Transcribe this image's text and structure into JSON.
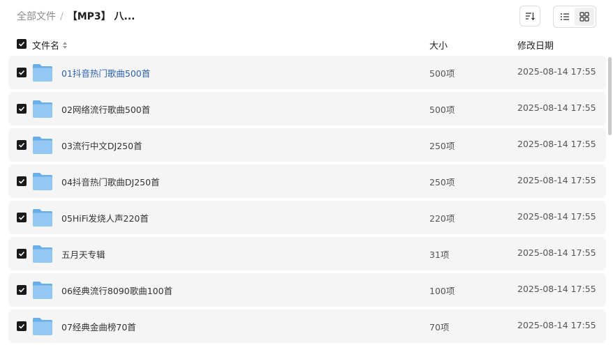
{
  "breadcrumb": {
    "root": "全部文件",
    "separator": "/",
    "current": "【MP3】 八..."
  },
  "toolbar": {
    "sort_icon": "sort-icon",
    "view_list_icon": "list-view-icon",
    "view_grid_icon": "grid-view-icon"
  },
  "header": {
    "name": "文件名",
    "size": "大小",
    "date": "修改日期"
  },
  "colors": {
    "row_bg": "#f5f5f5",
    "link": "#2a5fb8",
    "folder": "#7fb8ef"
  },
  "files": [
    {
      "name": "01抖音热门歌曲500首",
      "size": "500项",
      "date": "2025-08-14 17:55",
      "checked": true
    },
    {
      "name": "02网络流行歌曲500首",
      "size": "500项",
      "date": "2025-08-14 17:55",
      "checked": true
    },
    {
      "name": "03流行中文DJ250首",
      "size": "250项",
      "date": "2025-08-14 17:55",
      "checked": true
    },
    {
      "name": "04抖音热门歌曲DJ250首",
      "size": "250项",
      "date": "2025-08-14 17:55",
      "checked": true
    },
    {
      "name": "05HiFi发烧人声220首",
      "size": "220项",
      "date": "2025-08-14 17:55",
      "checked": true
    },
    {
      "name": "五月天专辑",
      "size": "31项",
      "date": "2025-08-14 17:55",
      "checked": true
    },
    {
      "name": "06经典流行8090歌曲100首",
      "size": "100项",
      "date": "2025-08-14 17:55",
      "checked": true
    },
    {
      "name": "07经典金曲榜70首",
      "size": "70项",
      "date": "2025-08-14 17:55",
      "checked": true
    }
  ]
}
